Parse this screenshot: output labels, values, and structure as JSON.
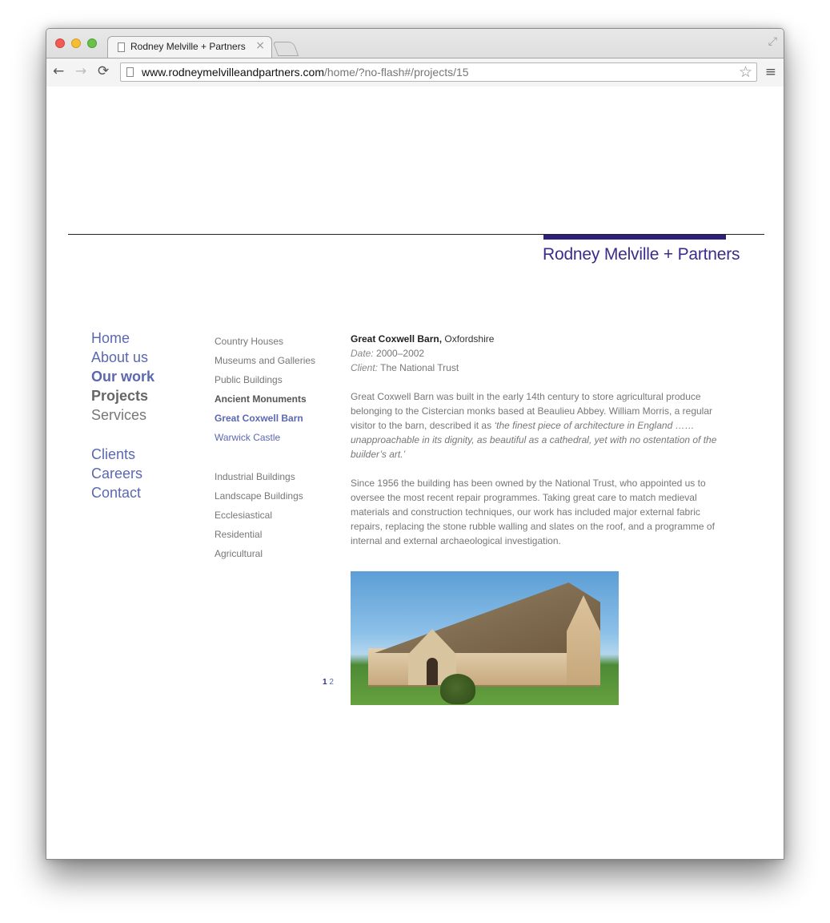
{
  "browser": {
    "tab_title": "Rodney Melville + Partners",
    "tab_close": "×",
    "url_host": "www.rodneymelvilleandpartners.com",
    "url_path": "/home/?no-flash#/projects/15",
    "back_glyph": "←",
    "forward_glyph": "→",
    "reload_glyph": "⟳",
    "star_glyph": "☆",
    "menu_glyph": "≡",
    "fullscreen_glyph": "⤢"
  },
  "site": {
    "logo": "Rodney Melville + Partners",
    "accent_color": "#2e1f7a",
    "link_color": "#5b68b0"
  },
  "main_nav": [
    {
      "label": "Home"
    },
    {
      "label": "About us"
    },
    {
      "label": "Our work"
    },
    {
      "label": "Projects"
    },
    {
      "label": "Services"
    },
    {
      "label": "Clients"
    },
    {
      "label": "Careers"
    },
    {
      "label": "Contact"
    }
  ],
  "sub_nav": [
    {
      "label": "Country Houses"
    },
    {
      "label": "Museums and Galleries"
    },
    {
      "label": "Public Buildings"
    },
    {
      "label": "Ancient Monuments"
    },
    {
      "label": "Great Coxwell Barn"
    },
    {
      "label": "Warwick Castle"
    },
    {
      "label": "Industrial Buildings"
    },
    {
      "label": "Landscape Buildings"
    },
    {
      "label": "Ecclesiastical"
    },
    {
      "label": "Residential"
    },
    {
      "label": "Agricultural"
    }
  ],
  "project": {
    "name": "Great Coxwell Barn,",
    "location": "Oxfordshire",
    "date_label": "Date:",
    "date_value": "2000–2002",
    "client_label": "Client:",
    "client_value": "The National Trust",
    "para1_text": "Great Coxwell Barn was built in the early 14th century to store agricultural produce belonging to the Cistercian monks based at Beaulieu Abbey. William Morris, a regular visitor to the barn, described it as",
    "para1_quote": "‘the finest piece of architecture in England …… unapproachable in its dignity, as beautiful as a cathedral, yet with no ostentation of the builder’s art.’",
    "para2": "Since 1956 the building has been owned by the National Trust, who appointed us to oversee the most recent repair programmes. Taking great care to match medieval materials and construction techniques, our work has included major external fabric repairs, replacing the stone rubble walling and slates on the roof, and a programme of internal and external archaeological investigation."
  },
  "pager": {
    "current": "1",
    "next": "2"
  }
}
